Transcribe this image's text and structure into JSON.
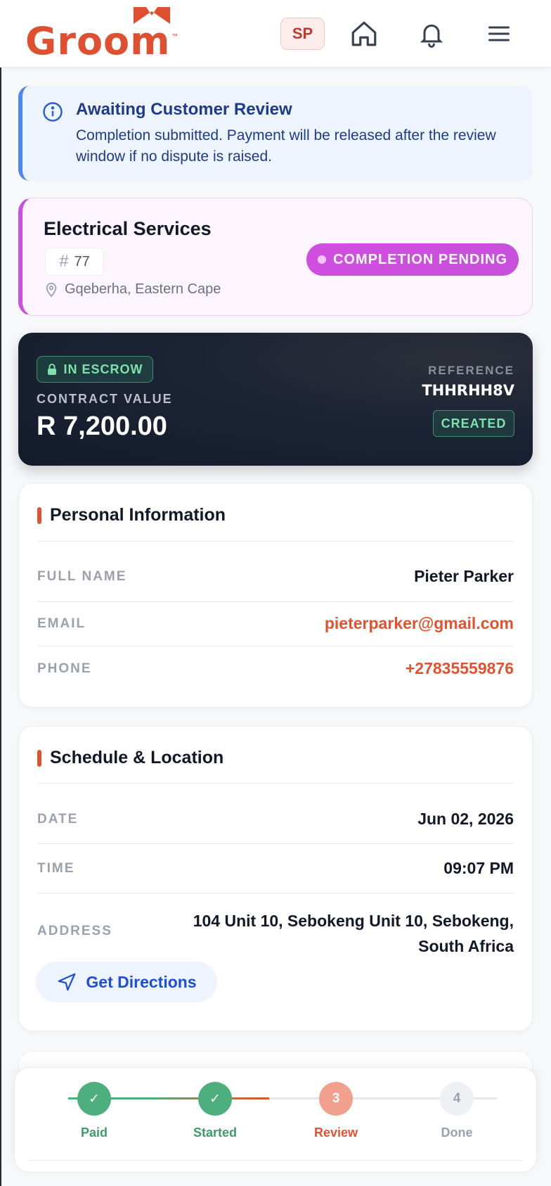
{
  "header": {
    "logo_text": "Groom",
    "logo_tm": "™",
    "user_initials": "SP"
  },
  "notice": {
    "title": "Awaiting Customer Review",
    "body": "Completion submitted. Payment will be released after the review window if no dispute is raised."
  },
  "service": {
    "title": "Electrical Services",
    "hash": "#",
    "id": "77",
    "location": "Gqeberha, Eastern Cape",
    "status": "COMPLETION PENDING"
  },
  "escrow": {
    "badge": "IN ESCROW",
    "contract_label": "CONTRACT VALUE",
    "contract_value": "R 7,200.00",
    "reference_label": "REFERENCE",
    "reference": "THHRHH8V",
    "state": "CREATED"
  },
  "personal": {
    "title": "Personal Information",
    "rows": [
      {
        "label": "FULL NAME",
        "value": "Pieter Parker"
      },
      {
        "label": "EMAIL",
        "value": "pieterparker@gmail.com"
      },
      {
        "label": "PHONE",
        "value": "+27835559876"
      }
    ]
  },
  "schedule": {
    "title": "Schedule & Location",
    "date_label": "DATE",
    "date": "Jun 02, 2026",
    "time_label": "TIME",
    "time": "09:07 PM",
    "address_label": "ADDRESS",
    "address_line1": "104 Unit 10, Sebokeng Unit 10, Sebokeng,",
    "address_line2": "South Africa",
    "directions_label": "Get Directions"
  },
  "progress": {
    "steps": [
      {
        "label": "Paid",
        "marker": "✓",
        "state": "done"
      },
      {
        "label": "Started",
        "marker": "✓",
        "state": "done"
      },
      {
        "label": "Review",
        "marker": "3",
        "state": "current"
      },
      {
        "label": "Done",
        "marker": "4",
        "state": "upcoming"
      }
    ]
  },
  "colors": {
    "brand": "#df5030",
    "success": "#4caf7d",
    "current": "#f0a08c",
    "upcoming": "#eef0f4",
    "link": "#e1532e",
    "info": "#1e3a8a",
    "purple": "#c84fe0"
  }
}
